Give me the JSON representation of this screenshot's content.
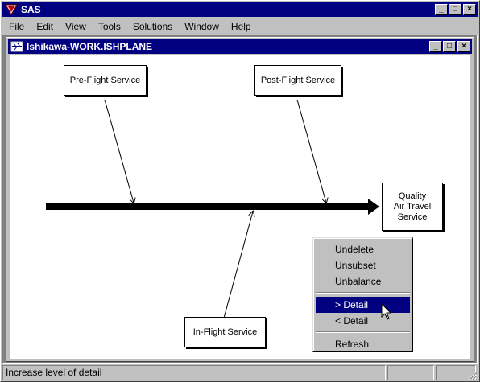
{
  "app": {
    "title": "SAS",
    "minimize": "_",
    "maximize": "□",
    "close": "×"
  },
  "menu": [
    {
      "label": "File"
    },
    {
      "label": "Edit"
    },
    {
      "label": "View"
    },
    {
      "label": "Tools"
    },
    {
      "label": "Solutions"
    },
    {
      "label": "Window"
    },
    {
      "label": "Help"
    }
  ],
  "child_window": {
    "title": "Ishikawa-WORK.ISHPLANE"
  },
  "diagram": {
    "causes": [
      "Pre-Flight Service",
      "Post-Flight Service",
      "In-Flight Service"
    ],
    "effect": [
      "Quality",
      "Air Travel",
      "Service"
    ]
  },
  "context_menu": {
    "items": [
      "Undelete",
      "Unsubset",
      "Unbalance",
      "> Detail",
      "< Detail",
      "Refresh"
    ],
    "selected": "> Detail"
  },
  "status": {
    "text": "Increase level of detail"
  },
  "icons": {
    "app": "sas-logo-icon",
    "child": "ishikawa-doc-icon",
    "cursor": "arrow-cursor-icon"
  },
  "colors": {
    "titlebar": "#000080",
    "face": "#c0c0c0",
    "selection": "#000080"
  }
}
